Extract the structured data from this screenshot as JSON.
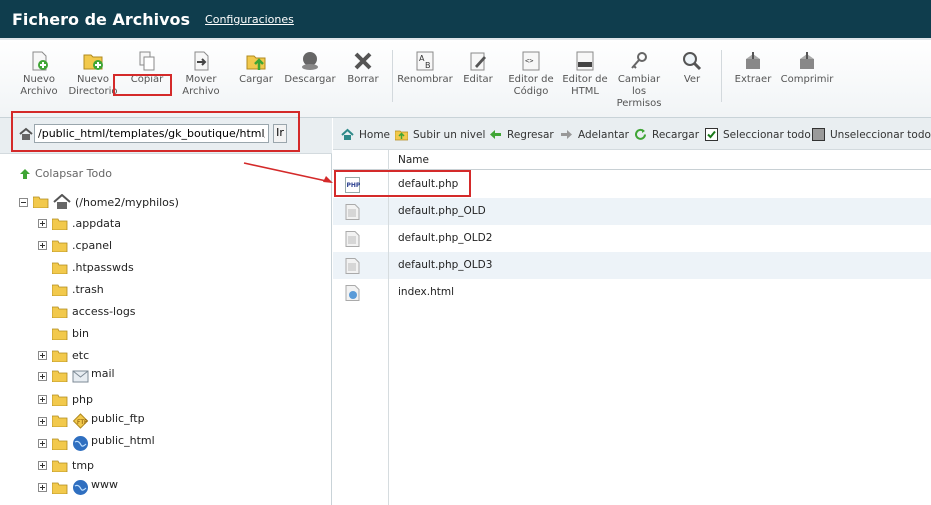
{
  "header": {
    "title": "Fichero de Archivos",
    "config_link": "Configuraciones"
  },
  "toolbar": {
    "items": [
      {
        "label": "Nuevo\nArchivo",
        "icon": "new-file-icon"
      },
      {
        "label": "Nuevo\nDirectorio",
        "icon": "new-folder-icon"
      },
      {
        "label": "Copiar",
        "icon": "copy-icon"
      },
      {
        "label": "Mover\nArchivo",
        "icon": "move-file-icon"
      },
      {
        "label": "Cargar",
        "icon": "upload-icon"
      },
      {
        "label": "Descargar",
        "icon": "download-icon"
      },
      {
        "label": "Borrar",
        "icon": "delete-icon"
      },
      {
        "label": "Renombrar",
        "icon": "rename-icon"
      },
      {
        "label": "Editar",
        "icon": "edit-icon"
      },
      {
        "label": "Editor de\nCódigo",
        "icon": "code-editor-icon"
      },
      {
        "label": "Editor de\nHTML",
        "icon": "html-editor-icon"
      },
      {
        "label": "Cambiar\nlos\nPermisos",
        "icon": "permissions-icon"
      },
      {
        "label": "Ver",
        "icon": "view-icon"
      },
      {
        "label": "Extraer",
        "icon": "extract-icon"
      },
      {
        "label": "Comprimir",
        "icon": "compress-icon"
      }
    ]
  },
  "pathbar": {
    "value": "/public_html/templates/gk_boutique/html/com_vir",
    "go_label": "Ir"
  },
  "tree": {
    "collapse_label": "Colapsar Todo",
    "root_label": "(/home2/myphilos)",
    "items": [
      {
        "label": ".appdata",
        "expandable": true,
        "icon": "folder-icon"
      },
      {
        "label": ".cpanel",
        "expandable": true,
        "icon": "folder-icon"
      },
      {
        "label": ".htpasswds",
        "expandable": false,
        "icon": "folder-icon"
      },
      {
        "label": ".trash",
        "expandable": false,
        "icon": "folder-icon"
      },
      {
        "label": "access-logs",
        "expandable": false,
        "icon": "folder-icon"
      },
      {
        "label": "bin",
        "expandable": false,
        "icon": "folder-icon"
      },
      {
        "label": "etc",
        "expandable": true,
        "icon": "folder-icon"
      },
      {
        "label": "mail",
        "expandable": true,
        "icon": "mail-icon"
      },
      {
        "label": "php",
        "expandable": true,
        "icon": "folder-icon"
      },
      {
        "label": "public_ftp",
        "expandable": true,
        "icon": "ftp-icon"
      },
      {
        "label": "public_html",
        "expandable": true,
        "icon": "globe-icon"
      },
      {
        "label": "tmp",
        "expandable": true,
        "icon": "folder-icon"
      },
      {
        "label": "www",
        "expandable": true,
        "icon": "globe-icon"
      }
    ]
  },
  "nav": {
    "home": "Home",
    "up": "Subir un nivel",
    "back": "Regresar",
    "forward": "Adelantar",
    "reload": "Recargar",
    "select_all": "Seleccionar todo",
    "unselect_all": "Unseleccionar todo"
  },
  "files": {
    "col_name": "Name",
    "rows": [
      {
        "name": "default.php",
        "type": "php"
      },
      {
        "name": "default.php_OLD",
        "type": "text"
      },
      {
        "name": "default.php_OLD2",
        "type": "text"
      },
      {
        "name": "default.php_OLD3",
        "type": "text"
      },
      {
        "name": "index.html",
        "type": "html"
      }
    ]
  },
  "colors": {
    "header_bg": "#0f3d4d",
    "highlight": "#d42a2a",
    "row_alt": "#edf3f8"
  }
}
